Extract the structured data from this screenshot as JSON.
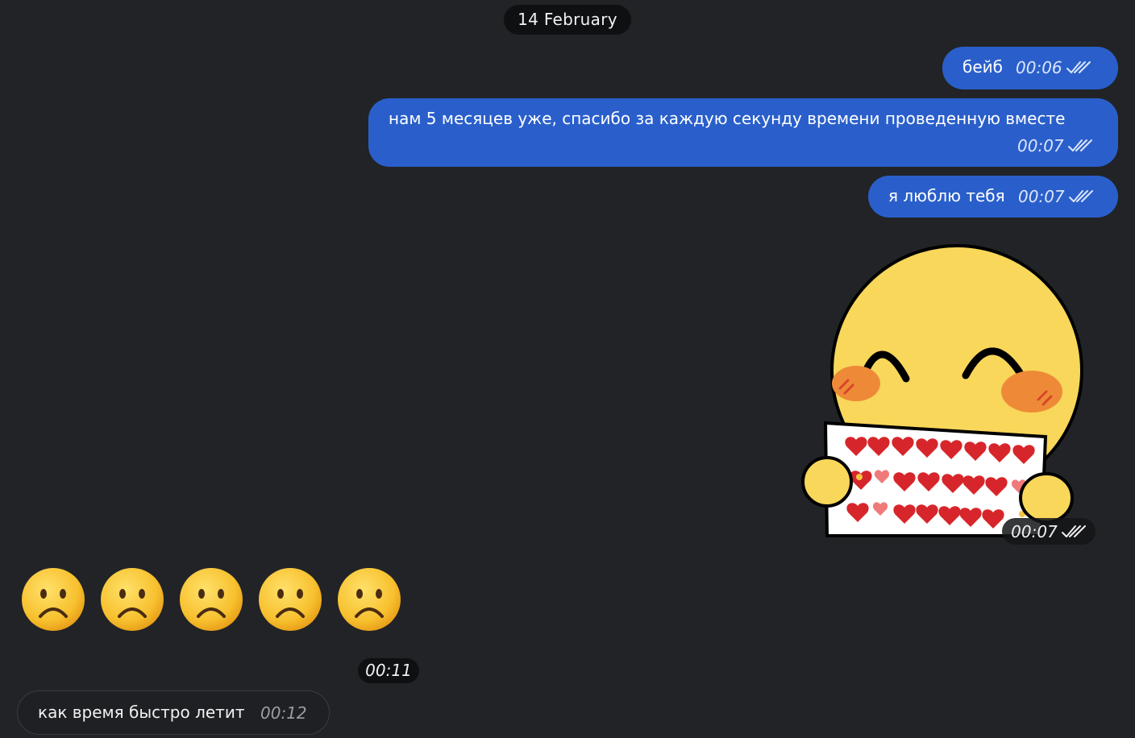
{
  "date_separator": "14 February",
  "messages_out": [
    {
      "text": "бейб",
      "time": "00:06"
    },
    {
      "text": "нам 5 месяцев уже, спасибо за каждую секунду времени проведенную вместе",
      "time": "00:07"
    },
    {
      "text": "я люблю тебя",
      "time": "00:07"
    }
  ],
  "sticker": {
    "icon": "blushing-smiley-holding-hearts-sign-sticker",
    "time": "00:07"
  },
  "emoji_message": {
    "icon": "frowning-face-icon",
    "count": 5,
    "time": "00:11"
  },
  "message_in": {
    "text": "как время быстро летит",
    "time": "00:12"
  },
  "colors": {
    "background": "#212326",
    "bubble_out": "#2a5fcb",
    "bubble_in": "#1e2023",
    "pill": "#0f1012"
  }
}
